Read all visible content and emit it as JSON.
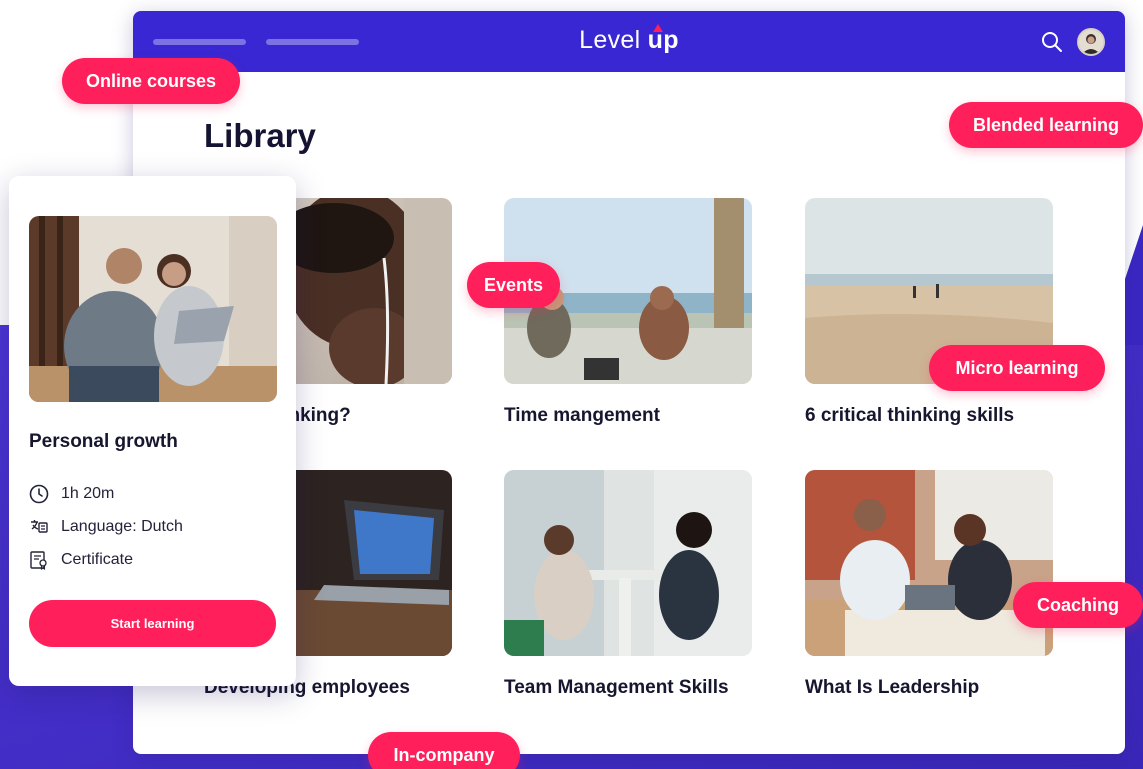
{
  "header": {
    "brand_text": "Level",
    "brand_accent": "up",
    "accent_color": "#ff1f5a",
    "bar_color": "#3827d3",
    "icons": [
      "search-icon",
      "avatar"
    ]
  },
  "library": {
    "title": "Library",
    "courses": [
      {
        "title": "ritical Thinking?"
      },
      {
        "title": "Time mangement"
      },
      {
        "title": "6 critical thinking skills"
      },
      {
        "title": "Developing employees"
      },
      {
        "title": "Team Management Skills"
      },
      {
        "title": "What Is Leadership"
      }
    ]
  },
  "detail": {
    "title": "Personal growth",
    "duration": "1h 20m",
    "language": "Language: Dutch",
    "certificate": "Certificate",
    "cta": "Start learning",
    "icons": [
      "clock-icon",
      "language-icon",
      "certificate-icon"
    ]
  },
  "tags": {
    "online": "Online courses",
    "blended": "Blended learning",
    "events": "Events",
    "micro": "Micro learning",
    "coaching": "Coaching",
    "incompany": "In-company"
  }
}
